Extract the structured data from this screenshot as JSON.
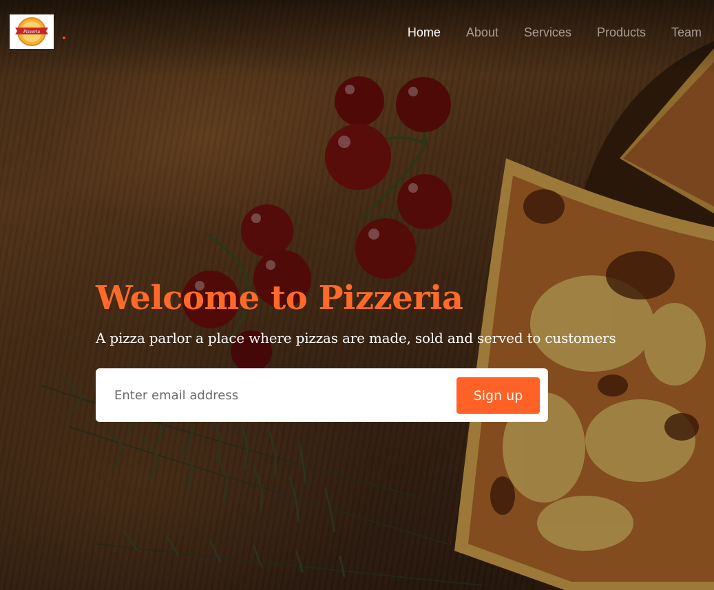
{
  "brand": {
    "logo_text": "Pizzeria",
    "accent_color": "#ff6a2b"
  },
  "nav": {
    "items": [
      {
        "label": "Home",
        "active": true
      },
      {
        "label": "About",
        "active": false
      },
      {
        "label": "Services",
        "active": false
      },
      {
        "label": "Products",
        "active": false
      },
      {
        "label": "Team",
        "active": false
      }
    ]
  },
  "hero": {
    "title": "Welcome to Pizzeria",
    "subtitle": "A pizza parlor a place where pizzas are made, sold and served to customers"
  },
  "signup": {
    "email_placeholder": "Enter email address",
    "email_value": "",
    "button_label": "Sign up",
    "button_color": "#ff6126"
  }
}
